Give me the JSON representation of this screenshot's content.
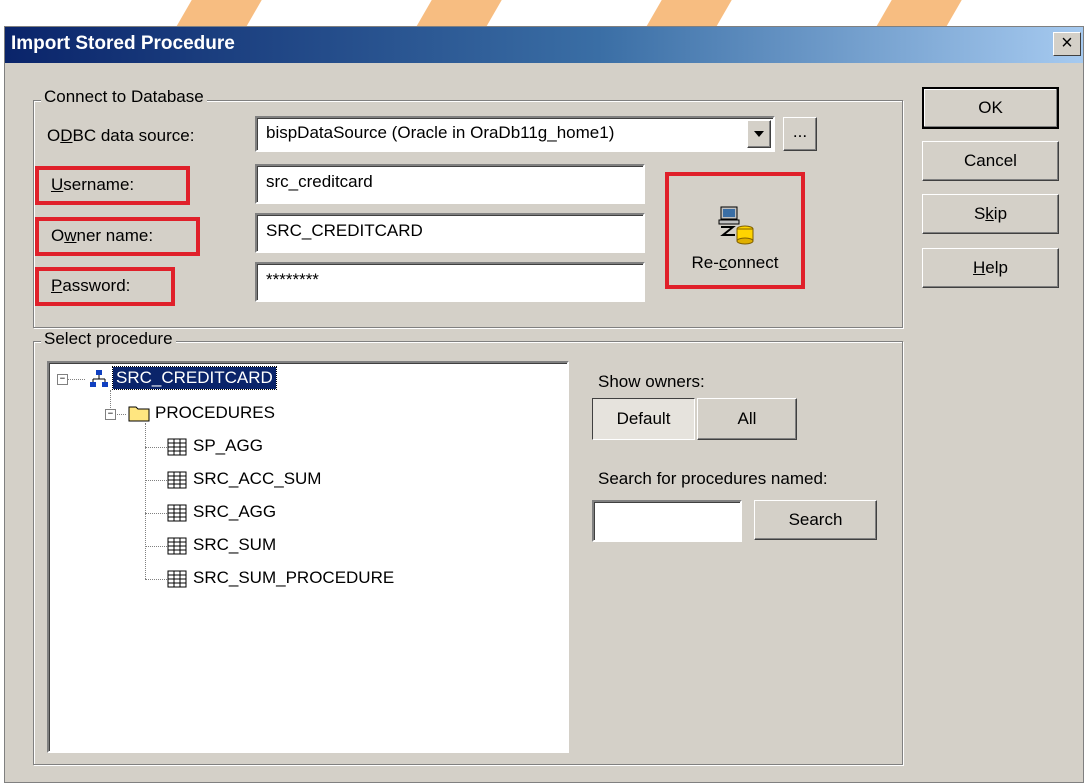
{
  "dialog": {
    "title": "Import Stored Procedure",
    "close_label": "×"
  },
  "connect": {
    "legend": "Connect to Database",
    "odbc_label_pre": "O",
    "odbc_label_ul": "D",
    "odbc_label_post": "BC data source:",
    "odbc_value": "bispDataSource (Oracle in OraDb11g_home1)",
    "browse_label": "...",
    "username_label_ul": "U",
    "username_label_rest": "sername:",
    "username_value": "src_creditcard",
    "owner_label_pre": "O",
    "owner_label_ul": "w",
    "owner_label_rest": "ner name:",
    "owner_value": "SRC_CREDITCARD",
    "password_label_ul": "P",
    "password_label_rest": "assword:",
    "password_value": "********",
    "reconnect_pre": "Re-",
    "reconnect_ul": "c",
    "reconnect_rest": "onnect"
  },
  "buttons": {
    "ok": "OK",
    "cancel": "Cancel",
    "skip_pre": "S",
    "skip_ul": "k",
    "skip_rest": "ip",
    "help_ul": "H",
    "help_rest": "elp"
  },
  "select": {
    "legend": "Select procedure",
    "tree": {
      "root": "SRC_CREDITCARD",
      "folder": "PROCEDURES",
      "items": [
        "SP_AGG",
        "SRC_ACC_SUM",
        "SRC_AGG",
        "SRC_SUM",
        "SRC_SUM_PROCEDURE"
      ]
    },
    "show_owners_label": "Show owners:",
    "default_label": "Default",
    "all_label": "All",
    "search_label": "Search for procedures named:",
    "search_value": "",
    "search_button": "Search"
  },
  "colors": {
    "highlight": "#e0202a",
    "selection": "#0a246a",
    "face": "#d4d0c8"
  }
}
